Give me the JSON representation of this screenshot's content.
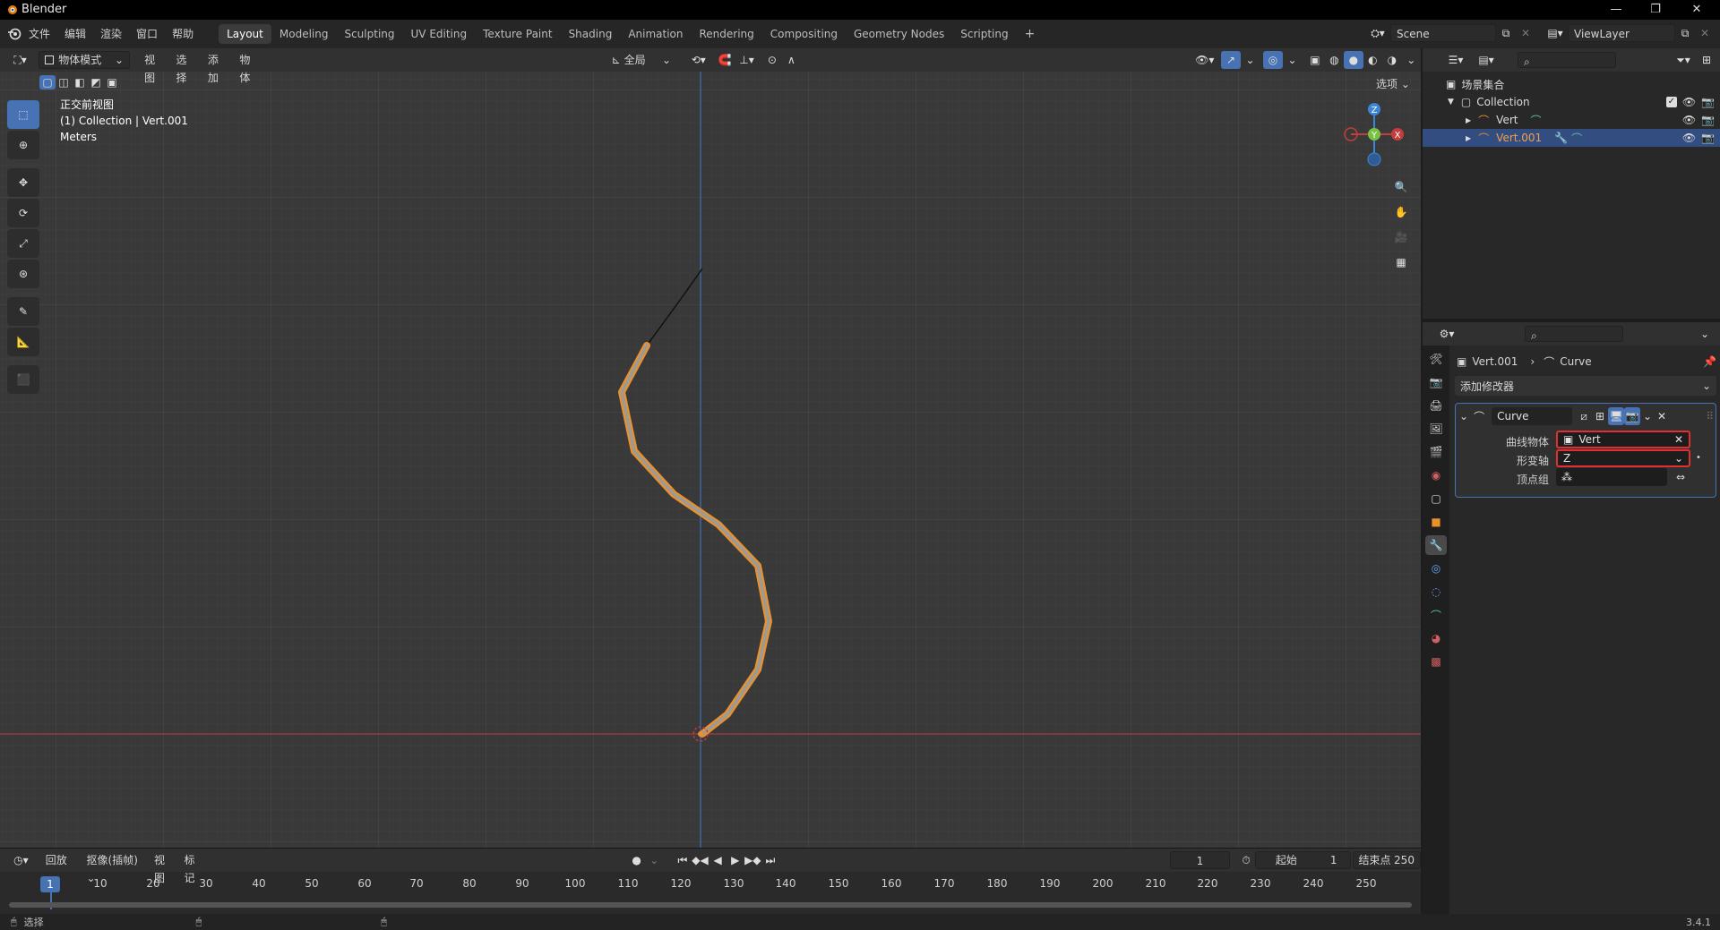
{
  "window": {
    "title": "Blender",
    "version": "3.4.1"
  },
  "topbar": {
    "menus": [
      "文件",
      "编辑",
      "渲染",
      "窗口",
      "帮助"
    ],
    "workspaces": [
      "Layout",
      "Modeling",
      "Sculpting",
      "UV Editing",
      "Texture Paint",
      "Shading",
      "Animation",
      "Rendering",
      "Compositing",
      "Geometry Nodes",
      "Scripting"
    ],
    "active_workspace": "Layout",
    "scene": "Scene",
    "view_layer": "ViewLayer"
  },
  "viewport": {
    "mode": "物体模式",
    "menus": [
      "视图",
      "选择",
      "添加",
      "物体"
    ],
    "transform_orientation": "全局",
    "options_label": "选项",
    "overlay_lines": [
      "正交前视图",
      "(1) Collection | Vert.001",
      "Meters"
    ],
    "gizmo": {
      "z": "Z",
      "y": "Y",
      "x": "X"
    }
  },
  "outliner": {
    "root": "场景集合",
    "collection": "Collection",
    "items": [
      {
        "name": "Vert",
        "selected": false
      },
      {
        "name": "Vert.001",
        "selected": true
      }
    ]
  },
  "properties": {
    "breadcrumb_object": "Vert.001",
    "breadcrumb_modifier": "Curve",
    "add_modifier": "添加修改器",
    "modifier": {
      "name": "Curve",
      "curve_object_label": "曲线物体",
      "curve_object_value": "Vert",
      "deform_axis_label": "形变轴",
      "deform_axis_value": "Z",
      "vertex_group_label": "顶点组",
      "vertex_group_value": ""
    }
  },
  "timeline": {
    "menus": [
      "回放",
      "抠像(插帧)",
      "视图",
      "标记"
    ],
    "current_frame": "1",
    "start_label": "起始",
    "start_value": "1",
    "end_label": "结束点",
    "end_value": "250",
    "frame_ticks": [
      "1",
      "10",
      "20",
      "30",
      "40",
      "50",
      "60",
      "70",
      "80",
      "90",
      "100",
      "110",
      "120",
      "130",
      "140",
      "150",
      "160",
      "170",
      "180",
      "190",
      "200",
      "210",
      "220",
      "230",
      "240",
      "250"
    ]
  },
  "statusbar": {
    "select_label": "选择"
  },
  "colors": {
    "accent": "#4772b3",
    "curve_orange": "#e8912d",
    "x_axis": "#c43c3c",
    "y_axis": "#7ac142",
    "z_axis": "#3b86d6",
    "highlight_red": "#e03030"
  }
}
